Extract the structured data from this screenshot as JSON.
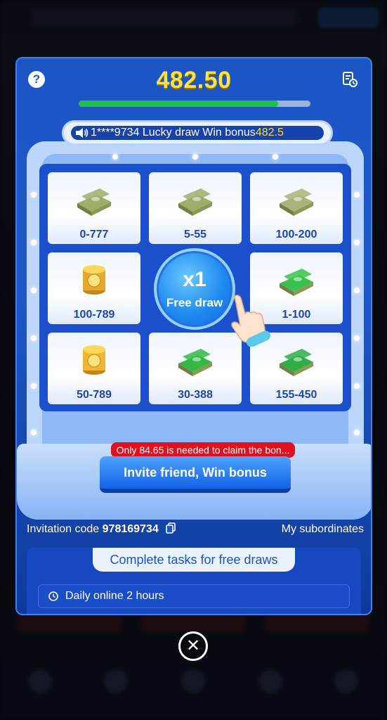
{
  "header": {
    "balance": "482.50",
    "progress_fraction": 0.86
  },
  "ticker": {
    "prefix": "1****9734 Lucky draw Win bonus",
    "amount": "482.5"
  },
  "prizes": [
    {
      "label": "0-777",
      "icon": "cash-stack-icon"
    },
    {
      "label": "5-55",
      "icon": "cash-stack-icon"
    },
    {
      "label": "100-200",
      "icon": "cash-pile-icon"
    },
    {
      "label": "100-789",
      "icon": "gold-coins-icon"
    },
    {
      "label": "1-100",
      "icon": "green-cash-icon"
    },
    {
      "label": "50-789",
      "icon": "gold-coin-stack-icon"
    },
    {
      "label": "30-388",
      "icon": "green-cash-pile-icon"
    },
    {
      "label": "155-450",
      "icon": "green-cash-stack-icon"
    }
  ],
  "draw": {
    "count": "x1",
    "label": "Free draw"
  },
  "claim_note": "Only 84.65 is needed to claim the bon...",
  "invite_button": "Invite friend, Win bonus",
  "invitation": {
    "label": "Invitation code",
    "code": "978169734",
    "subordinates_link": "My subordinates"
  },
  "tasks": {
    "title": "Complete tasks for free draws",
    "items": [
      {
        "label": "Daily online 2 hours"
      }
    ]
  },
  "colors": {
    "balance": "#ffe23a",
    "modal": "#1c56c6",
    "prize_text": "#1c45b5",
    "claim_note": "#e0101f"
  }
}
